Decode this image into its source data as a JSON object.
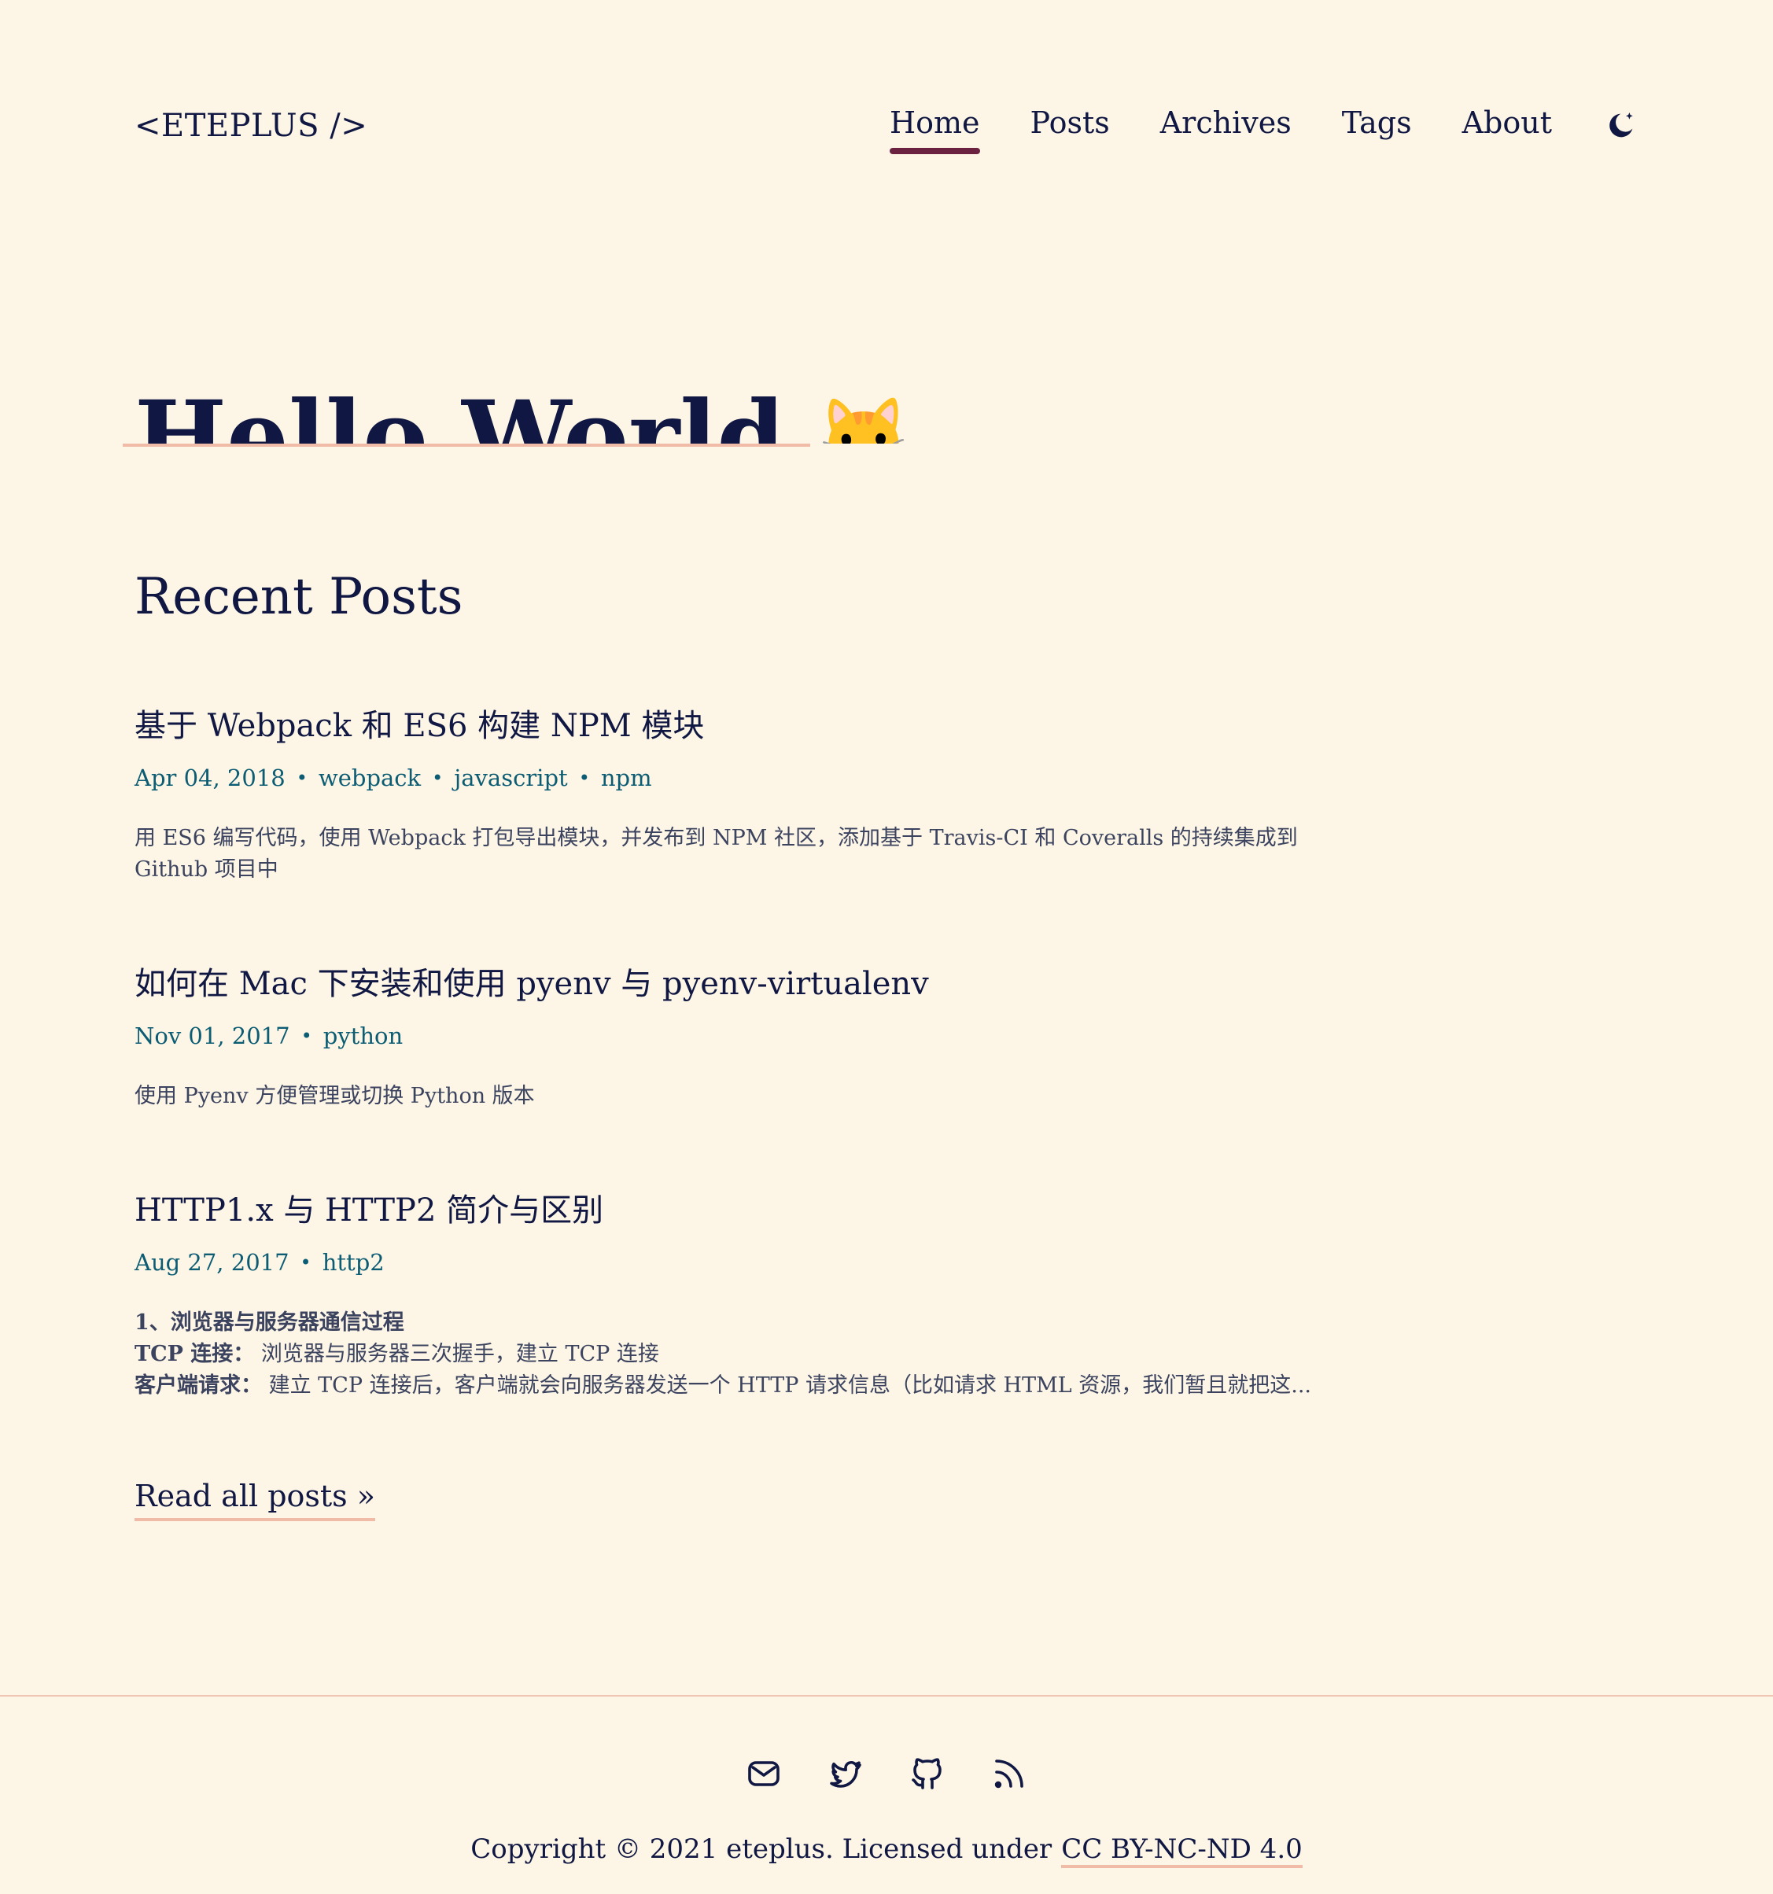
{
  "site": {
    "logo": "<ETEPLUS />"
  },
  "nav": {
    "items": [
      {
        "label": "Home",
        "active": true
      },
      {
        "label": "Posts"
      },
      {
        "label": "Archives"
      },
      {
        "label": "Tags"
      },
      {
        "label": "About"
      }
    ],
    "theme_toggle_icon": "moon-icon"
  },
  "hero": {
    "title": "Hello World",
    "emoji": "🐱"
  },
  "recent": {
    "title": "Recent Posts",
    "posts": [
      {
        "title": "基于 Webpack 和 ES6 构建 NPM 模块",
        "date": "Apr 04, 2018",
        "tags": [
          "webpack",
          "javascript",
          "npm"
        ],
        "desc": "用 ES6 编写代码，使用 Webpack 打包导出模块，并发布到 NPM 社区，添加基于 Travis-CI 和 Coveralls 的持续集成到 Github 项目中"
      },
      {
        "title": "如何在 Mac 下安装和使用 pyenv 与 pyenv-virtualenv",
        "date": "Nov 01, 2017",
        "tags": [
          "python"
        ],
        "desc": "使用 Pyenv 方便管理或切换 Python 版本"
      },
      {
        "title": "HTTP1.x 与 HTTP2 简介与区别",
        "date": "Aug 27, 2017",
        "tags": [
          "http2"
        ],
        "desc_lines": [
          {
            "bold": "1、浏览器与服务器通信过程",
            "text": ""
          },
          {
            "bold": "TCP 连接：",
            "text": " 浏览器与服务器三次握手，建立 TCP 连接"
          },
          {
            "bold": "客户端请求：",
            "text": " 建立 TCP 连接后，客户端就会向服务器发送一个 HTTP 请求信息（比如请求 HTML 资源，我们暂且就把这..."
          }
        ]
      }
    ],
    "read_all": "Read all posts »"
  },
  "footer": {
    "icons": [
      "mail-icon",
      "twitter-icon",
      "github-icon",
      "rss-icon"
    ],
    "copyright": "Copyright © 2021 eteplus. Licensed under",
    "license": "CC BY-NC-ND 4.0"
  },
  "colors": {
    "background": "#fdf6e6",
    "text": "#0f1742",
    "meta": "#0c5c73",
    "accent": "#6b2140",
    "underline": "#f0bca8"
  }
}
